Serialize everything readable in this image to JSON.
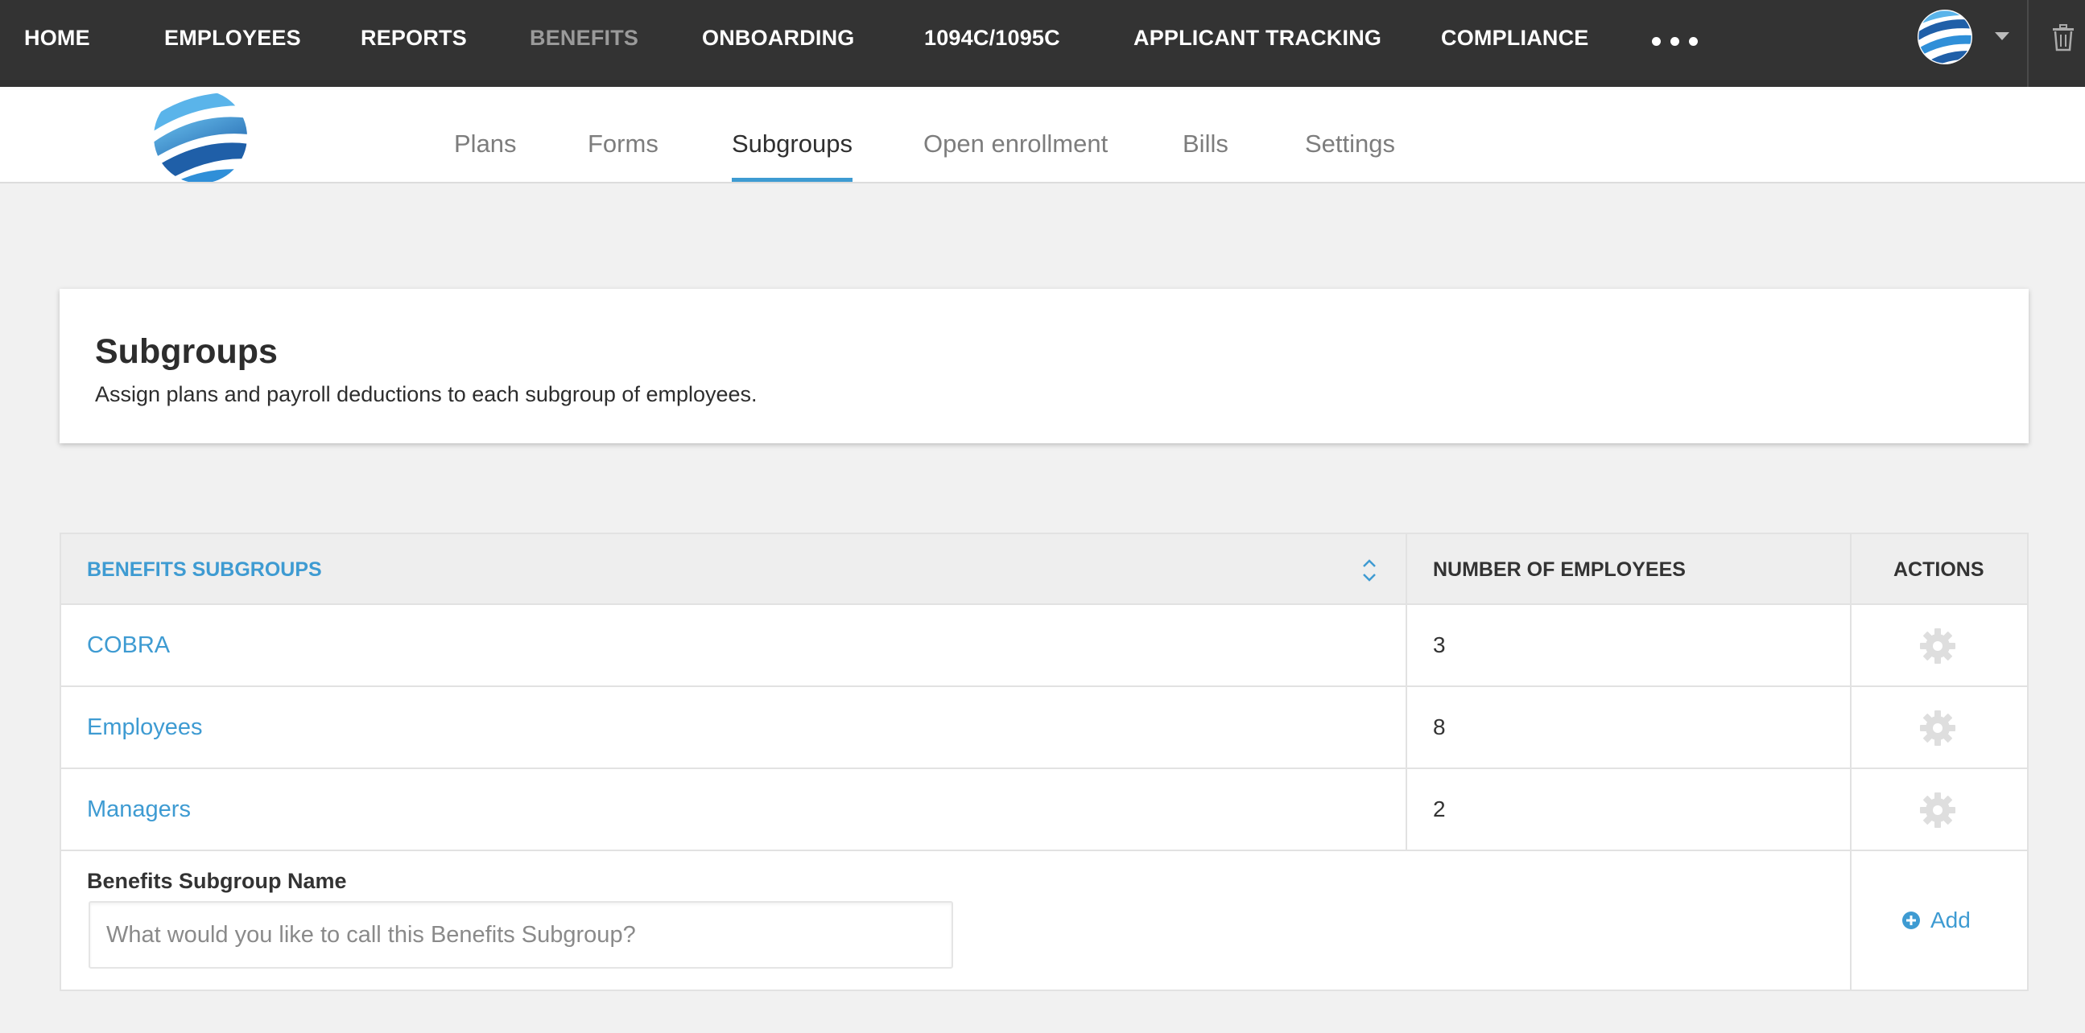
{
  "topnav": {
    "items": [
      {
        "label": "HOME"
      },
      {
        "label": "EMPLOYEES"
      },
      {
        "label": "REPORTS"
      },
      {
        "label": "BENEFITS",
        "active": true
      },
      {
        "label": "ONBOARDING"
      },
      {
        "label": "1094C/1095C"
      },
      {
        "label": "APPLICANT TRACKING"
      },
      {
        "label": "COMPLIANCE"
      }
    ],
    "more_icon": "more-horizontal-icon",
    "avatar_icon": "globe-logo",
    "caret_icon": "chevron-down-icon",
    "trash_icon": "trash-icon"
  },
  "subnav": {
    "logo": "globe-logo",
    "tabs": [
      {
        "label": "Plans"
      },
      {
        "label": "Forms"
      },
      {
        "label": "Subgroups",
        "active": true
      },
      {
        "label": "Open enrollment"
      },
      {
        "label": "Bills"
      },
      {
        "label": "Settings"
      }
    ]
  },
  "header": {
    "title": "Subgroups",
    "description": "Assign plans and payroll deductions to each subgroup of employees."
  },
  "table": {
    "columns": {
      "subgroups": "BENEFITS SUBGROUPS",
      "employees": "NUMBER OF EMPLOYEES",
      "actions": "ACTIONS"
    },
    "rows": [
      {
        "name": "COBRA",
        "count": "3"
      },
      {
        "name": "Employees",
        "count": "8"
      },
      {
        "name": "Managers",
        "count": "2"
      }
    ],
    "add": {
      "label": "Benefits Subgroup Name",
      "placeholder": "What would you like to call this Benefits Subgroup?",
      "value": "",
      "button_label": "Add"
    }
  },
  "colors": {
    "topnav_bg": "#333333",
    "accent": "#3e9bd2",
    "page_bg": "#f1f1f1"
  }
}
